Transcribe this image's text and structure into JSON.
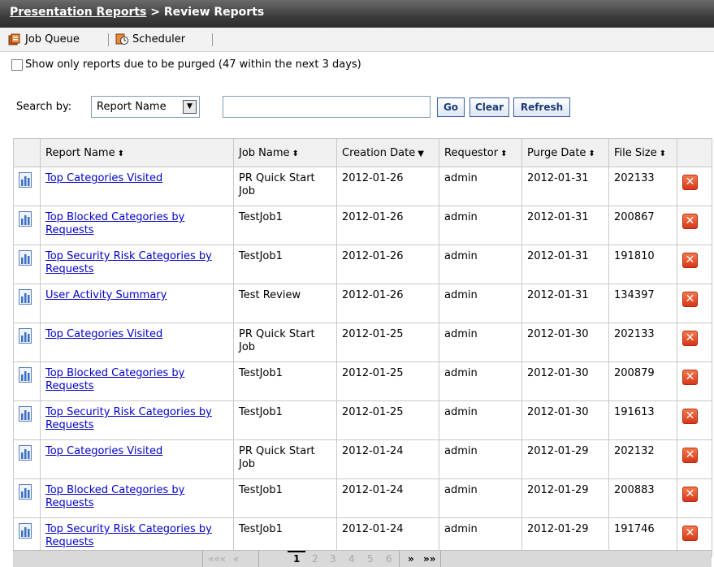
{
  "header": {
    "crumb_root": "Presentation Reports",
    "crumb_sep": ">",
    "crumb_current": "Review Reports"
  },
  "toolbar": {
    "job_queue": "Job Queue",
    "scheduler": "Scheduler"
  },
  "filter": {
    "purge_label": "Show only reports due to be purged (47 within the next 3 days)",
    "purge_checked": false
  },
  "search": {
    "label": "Search by:",
    "field_selected": "Report Name",
    "value": "",
    "go": "Go",
    "clear": "Clear",
    "refresh": "Refresh"
  },
  "table": {
    "columns": [
      "Report Name",
      "Job Name",
      "Creation Date",
      "Requestor",
      "Purge Date",
      "File Size"
    ],
    "sort_icons": [
      "⬍",
      "⬍",
      "▼",
      "⬍",
      "⬍",
      "⬍"
    ],
    "rows": [
      {
        "report": "Top Categories Visited",
        "job": "PR Quick Start Job",
        "created": "2012-01-26",
        "requestor": "admin",
        "purge": "2012-01-31",
        "size": "202133"
      },
      {
        "report": "Top Blocked Categories by Requests",
        "job": "TestJob1",
        "created": "2012-01-26",
        "requestor": "admin",
        "purge": "2012-01-31",
        "size": "200867"
      },
      {
        "report": "Top Security Risk Categories by Requests",
        "job": "TestJob1",
        "created": "2012-01-26",
        "requestor": "admin",
        "purge": "2012-01-31",
        "size": "191810"
      },
      {
        "report": "User Activity Summary",
        "job": "Test Review",
        "created": "2012-01-26",
        "requestor": "admin",
        "purge": "2012-01-31",
        "size": "134397"
      },
      {
        "report": "Top Categories Visited",
        "job": "PR Quick Start Job",
        "created": "2012-01-25",
        "requestor": "admin",
        "purge": "2012-01-30",
        "size": "202133"
      },
      {
        "report": "Top Blocked Categories by Requests",
        "job": "TestJob1",
        "created": "2012-01-25",
        "requestor": "admin",
        "purge": "2012-01-30",
        "size": "200879"
      },
      {
        "report": "Top Security Risk Categories by Requests",
        "job": "TestJob1",
        "created": "2012-01-25",
        "requestor": "admin",
        "purge": "2012-01-30",
        "size": "191613"
      },
      {
        "report": "Top Categories Visited",
        "job": "PR Quick Start Job",
        "created": "2012-01-24",
        "requestor": "admin",
        "purge": "2012-01-29",
        "size": "202132"
      },
      {
        "report": "Top Blocked Categories by Requests",
        "job": "TestJob1",
        "created": "2012-01-24",
        "requestor": "admin",
        "purge": "2012-01-29",
        "size": "200883"
      },
      {
        "report": "Top Security Risk Categories by Requests",
        "job": "TestJob1",
        "created": "2012-01-24",
        "requestor": "admin",
        "purge": "2012-01-29",
        "size": "191746"
      }
    ],
    "report_icon": "report-chart-icon",
    "delete_icon": "delete-x-icon",
    "delete_glyph": "✕"
  },
  "pager": {
    "first": "«««",
    "prev": "«",
    "pages": [
      "1",
      "2",
      "3",
      "4",
      "5",
      "6"
    ],
    "current": "1",
    "next": "»",
    "last": "»»"
  },
  "colors": {
    "link": "#0000cc",
    "header_bar": "#3c3c3c",
    "button_text": "#1c3d78",
    "delete": "#d8361a"
  }
}
